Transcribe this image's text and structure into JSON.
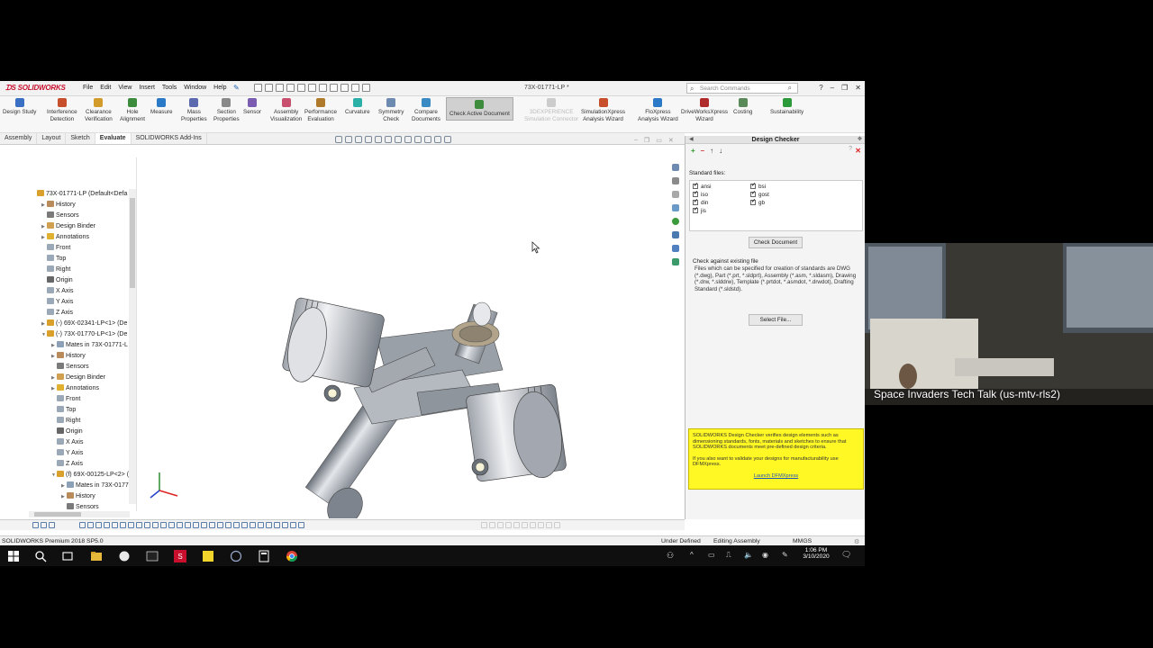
{
  "app": {
    "logo_text": "SOLIDWORKS",
    "menu": [
      "File",
      "Edit",
      "View",
      "Insert",
      "Tools",
      "Window",
      "Help"
    ],
    "doc_title": "73X-01771-LP *",
    "search_placeholder": "Search Commands"
  },
  "commands": [
    {
      "label": "Design Study",
      "color": "#3a6fc4"
    },
    {
      "label": "Interference\nDetection",
      "color": "#c84f2b"
    },
    {
      "label": "Clearance\nVerification",
      "color": "#d29b2a"
    },
    {
      "label": "Hole\nAlignment",
      "color": "#3d8c3d"
    },
    {
      "label": "Measure",
      "color": "#2b7ac8"
    },
    {
      "label": "Mass\nProperties",
      "color": "#5c6bb0"
    },
    {
      "label": "Section\nProperties",
      "color": "#8a8a8a"
    },
    {
      "label": "Sensor",
      "color": "#7a5cb0"
    },
    {
      "label": "Assembly\nVisualization",
      "color": "#c84f6d"
    },
    {
      "label": "Performance\nEvaluation",
      "color": "#b07a2b"
    },
    {
      "label": "Curvature",
      "color": "#2bb0a8"
    },
    {
      "label": "Symmetry\nCheck",
      "color": "#6d8ab0"
    },
    {
      "label": "Compare\nDocuments",
      "color": "#3a8ac4"
    },
    {
      "label": "Check Active Document",
      "color": "#3d8c3d"
    },
    {
      "label": "3DEXPERIENCE\nSimulation Connector",
      "color": "#cccccc"
    },
    {
      "label": "SimulationXpress\nAnalysis Wizard",
      "color": "#c84f2b"
    },
    {
      "label": "FloXpress\nAnalysis Wizard",
      "color": "#2b7ac8"
    },
    {
      "label": "DriveWorksXpress\nWizard",
      "color": "#b02b2b"
    },
    {
      "label": "Costing",
      "color": "#5a8a5a"
    },
    {
      "label": "Sustainability",
      "color": "#2b9a3a"
    }
  ],
  "tabs": [
    "Assembly",
    "Layout",
    "Sketch",
    "Evaluate",
    "SOLIDWORKS Add-Ins"
  ],
  "active_tab": "Evaluate",
  "tree": [
    {
      "label": "73X-01771-LP  (Default<Defa",
      "indent": 0,
      "icon": "#d9a02b",
      "tri": ""
    },
    {
      "label": "History",
      "indent": 1,
      "icon": "#b98b5a",
      "tri": "▶"
    },
    {
      "label": "Sensors",
      "indent": 1,
      "icon": "#7a7a7a",
      "tri": ""
    },
    {
      "label": "Design Binder",
      "indent": 1,
      "icon": "#d0a050",
      "tri": "▶"
    },
    {
      "label": "Annotations",
      "indent": 1,
      "icon": "#e0b030",
      "tri": "▶"
    },
    {
      "label": "Front",
      "indent": 1,
      "icon": "#9aa8b8",
      "tri": ""
    },
    {
      "label": "Top",
      "indent": 1,
      "icon": "#9aa8b8",
      "tri": ""
    },
    {
      "label": "Right",
      "indent": 1,
      "icon": "#9aa8b8",
      "tri": ""
    },
    {
      "label": "Origin",
      "indent": 1,
      "icon": "#666666",
      "tri": ""
    },
    {
      "label": "X Axis",
      "indent": 1,
      "icon": "#9aa8b8",
      "tri": ""
    },
    {
      "label": "Y Axis",
      "indent": 1,
      "icon": "#9aa8b8",
      "tri": ""
    },
    {
      "label": "Z Axis",
      "indent": 1,
      "icon": "#9aa8b8",
      "tri": ""
    },
    {
      "label": "(-) 69X-02341-LP<1> (De",
      "indent": 1,
      "icon": "#d9a02b",
      "tri": "▶"
    },
    {
      "label": "(-) 73X-01770-LP<1> (De",
      "indent": 1,
      "icon": "#d9a02b",
      "tri": "▼"
    },
    {
      "label": "Mates in 73X-01771-L",
      "indent": 2,
      "icon": "#8ca0b8",
      "tri": "▶"
    },
    {
      "label": "History",
      "indent": 2,
      "icon": "#b98b5a",
      "tri": "▶"
    },
    {
      "label": "Sensors",
      "indent": 2,
      "icon": "#7a7a7a",
      "tri": ""
    },
    {
      "label": "Design Binder",
      "indent": 2,
      "icon": "#d0a050",
      "tri": "▶"
    },
    {
      "label": "Annotations",
      "indent": 2,
      "icon": "#e0b030",
      "tri": "▶"
    },
    {
      "label": "Front",
      "indent": 2,
      "icon": "#9aa8b8",
      "tri": ""
    },
    {
      "label": "Top",
      "indent": 2,
      "icon": "#9aa8b8",
      "tri": ""
    },
    {
      "label": "Right",
      "indent": 2,
      "icon": "#9aa8b8",
      "tri": ""
    },
    {
      "label": "Origin",
      "indent": 2,
      "icon": "#666666",
      "tri": ""
    },
    {
      "label": "X Axis",
      "indent": 2,
      "icon": "#9aa8b8",
      "tri": ""
    },
    {
      "label": "Y Axis",
      "indent": 2,
      "icon": "#9aa8b8",
      "tri": ""
    },
    {
      "label": "Z Axis",
      "indent": 2,
      "icon": "#9aa8b8",
      "tri": ""
    },
    {
      "label": "(f) 69X-00125-LP<2> (",
      "indent": 2,
      "icon": "#d9a02b",
      "tri": "▼"
    },
    {
      "label": "Mates in 73X-0177",
      "indent": 3,
      "icon": "#8ca0b8",
      "tri": "▶"
    },
    {
      "label": "History",
      "indent": 3,
      "icon": "#b98b5a",
      "tri": "▶"
    },
    {
      "label": "Sensors",
      "indent": 3,
      "icon": "#7a7a7a",
      "tri": ""
    }
  ],
  "design_checker": {
    "title": "Design Checker",
    "standard_files_label": "Standard files:",
    "standards_col1": [
      "ansi",
      "iso",
      "din",
      "jis"
    ],
    "standards_col2": [
      "bsi",
      "gost",
      "gb"
    ],
    "check_document_button": "Check Document",
    "check_existing_label": "Check against existing file",
    "check_existing_desc": "Files which can be specified for creation of standards are DWG (*.dwg), Part (*.prt, *.sldprt), Assembly (*.asm, *.sldasm), Drawing (*.drw, *.slddrw), Template (*.prtdot, *.asmdot, *.drwdot), Drafting Standard (*.sldstd).",
    "select_file_button": "Select File...",
    "info_text_1": "SOLIDWORKS Design Checker verifies design elements such as dimensioning standards, fonts, materials and sketches to ensure that SOLIDWORKS documents meet pre-defined design criteria.",
    "info_text_2": "If you also want to validate your designs for manufacturability use DFMXpress.",
    "info_link": "Launch DFMXpress"
  },
  "status": {
    "version": "SOLIDWORKS Premium 2018 SP5.0",
    "state": "Under Defined",
    "mode": "Editing Assembly",
    "units": "MMGS"
  },
  "taskbar": {
    "time": "1:06 PM",
    "date": "3/10/2020"
  },
  "video": {
    "caption": "Space Invaders Tech Talk (us-mtv-rls2)"
  }
}
